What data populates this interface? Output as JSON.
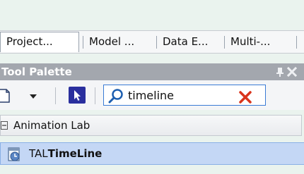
{
  "tabs": [
    {
      "label": "Project..."
    },
    {
      "label": "Model ..."
    },
    {
      "label": "Data E..."
    },
    {
      "label": "Multi-..."
    }
  ],
  "tool_palette": {
    "title": "Tool Palette",
    "search": {
      "value": "timeline",
      "placeholder": ""
    },
    "category": {
      "label": "Animation Lab"
    },
    "item": {
      "prefix": "TAL",
      "highlight": "TimeLine"
    }
  },
  "colors": {
    "accent": "#3a7bd5",
    "selection": "#c4d7f5",
    "clear_icon": "#d9341c"
  }
}
